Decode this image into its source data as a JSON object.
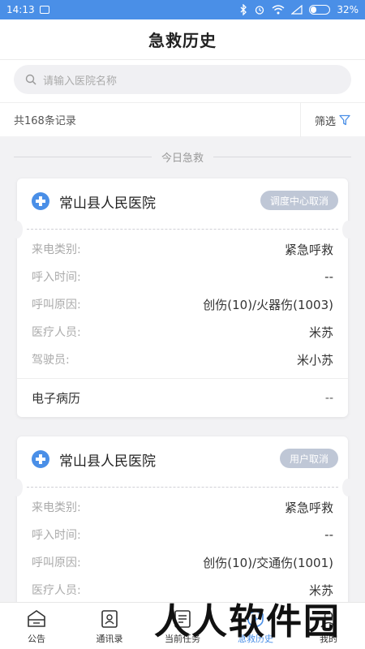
{
  "status_bar": {
    "time": "14:13",
    "battery": "32%",
    "battery_level": 0.32
  },
  "header": {
    "title": "急救历史"
  },
  "search": {
    "placeholder": "请输入医院名称"
  },
  "filter_bar": {
    "count_text": "共168条记录",
    "filter_label": "筛选"
  },
  "section": {
    "label": "今日急救"
  },
  "cards": [
    {
      "hospital": "常山县人民医院",
      "status": "调度中心取消",
      "rows": [
        {
          "label": "来电类别:",
          "value": "紧急呼救"
        },
        {
          "label": "呼入时间:",
          "value": "--"
        },
        {
          "label": "呼叫原因:",
          "value": "创伤(10)/火器伤(1003)"
        },
        {
          "label": "医疗人员:",
          "value": "米苏"
        },
        {
          "label": "驾驶员:",
          "value": "米小苏"
        }
      ],
      "footer": {
        "label": "电子病历",
        "value": "--"
      }
    },
    {
      "hospital": "常山县人民医院",
      "status": "用户取消",
      "rows": [
        {
          "label": "来电类别:",
          "value": "紧急呼救"
        },
        {
          "label": "呼入时间:",
          "value": "--"
        },
        {
          "label": "呼叫原因:",
          "value": "创伤(10)/交通伤(1001)"
        },
        {
          "label": "医疗人员:",
          "value": "米苏"
        }
      ]
    }
  ],
  "tabbar": {
    "tabs": [
      {
        "label": "公告",
        "icon": "announcement-icon"
      },
      {
        "label": "通讯录",
        "icon": "contacts-icon"
      },
      {
        "label": "当前任务",
        "icon": "task-icon"
      },
      {
        "label": "急救历史",
        "icon": "history-icon"
      },
      {
        "label": "我的",
        "icon": "profile-icon"
      }
    ],
    "active_index": 3
  },
  "watermark": {
    "text": "人人软件园"
  },
  "colors": {
    "accent": "#4a8fe7",
    "badge": "#bfc7d6"
  }
}
